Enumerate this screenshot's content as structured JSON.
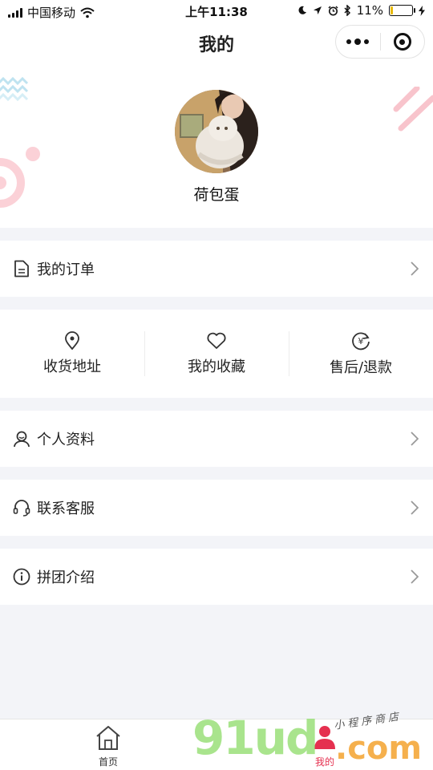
{
  "status_bar": {
    "carrier": "中国移动",
    "time": "上午11:38",
    "battery_text": "11%",
    "battery_level": 0.11,
    "icons": [
      "signal-icon",
      "wifi-icon",
      "moon-icon",
      "location-icon",
      "alarm-icon",
      "bluetooth-icon",
      "battery-icon",
      "charging-icon"
    ]
  },
  "nav": {
    "title": "我的"
  },
  "profile": {
    "nickname": "荷包蛋"
  },
  "menu": {
    "orders": {
      "label": "我的订单",
      "icon": "document-icon"
    },
    "quick": [
      {
        "label": "收货地址",
        "icon": "location-pin-icon"
      },
      {
        "label": "我的收藏",
        "icon": "heart-icon"
      },
      {
        "label": "售后/退款",
        "icon": "refund-yen-icon"
      }
    ],
    "profile_info": {
      "label": "个人资料",
      "icon": "user-icon"
    },
    "support": {
      "label": "联系客服",
      "icon": "headset-icon"
    },
    "group_intro": {
      "label": "拼团介绍",
      "icon": "info-icon"
    }
  },
  "tabbar": {
    "items": [
      {
        "label": "首页",
        "icon": "home-icon",
        "active": false
      },
      {
        "label": "我的",
        "icon": "user-icon",
        "active": true
      }
    ]
  },
  "watermark": {
    "brand": "91ud",
    "domain": ".com",
    "text": "小程序商店"
  },
  "colors": {
    "accent": "#e5304f",
    "background": "#f3f4f8",
    "text": "#222222"
  }
}
